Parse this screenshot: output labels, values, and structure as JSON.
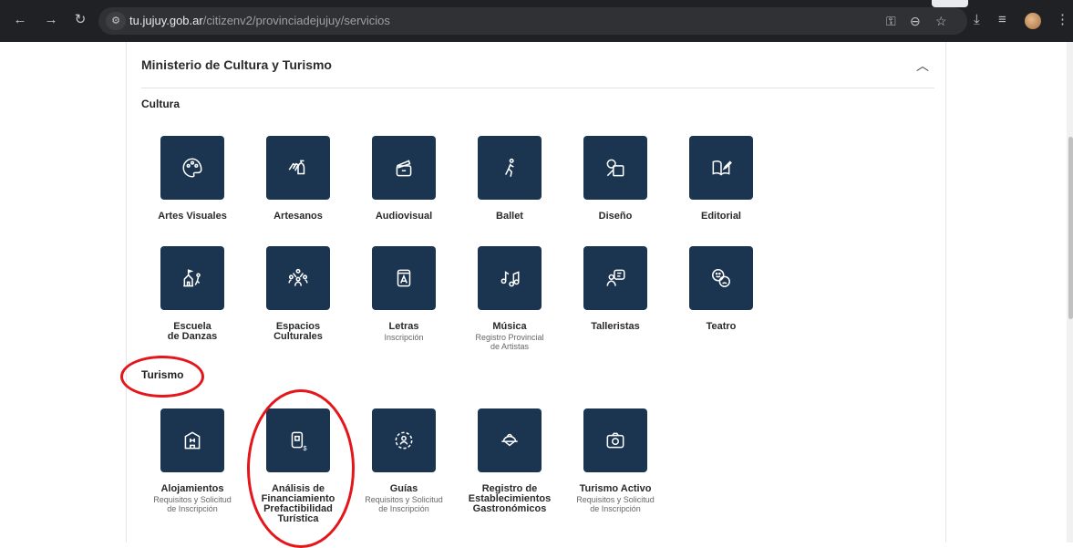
{
  "browser": {
    "url_host": "tu.jujuy.gob.ar",
    "url_path": "/citizenv2/provinciadejujuy/servicios",
    "site_info_icon": "tune-icon",
    "colors": {
      "frame": "#202124",
      "omnibox": "#303134"
    }
  },
  "panel": {
    "title": "Ministerio de Cultura y Turismo",
    "expanded": true
  },
  "cultura": {
    "heading": "Cultura",
    "row1": [
      {
        "label": "Artes Visuales",
        "icon": "palette-icon"
      },
      {
        "label": "Artesanos",
        "icon": "hands-pottery-icon"
      },
      {
        "label": "Audiovisual",
        "icon": "clapperboard-icon"
      },
      {
        "label": "Ballet",
        "icon": "dancer-icon"
      },
      {
        "label": "Diseño",
        "icon": "design-shapes-icon"
      },
      {
        "label": "Editorial",
        "icon": "book-pen-icon"
      }
    ],
    "row2": [
      {
        "label": "Escuela\nde Danzas",
        "icon": "dance-school-icon"
      },
      {
        "label": "Espacios\nCulturales",
        "icon": "community-icon"
      },
      {
        "label": "Letras",
        "sub": "Inscripción",
        "icon": "letter-card-icon"
      },
      {
        "label": "Música",
        "sub": "Registro Provincial\nde Artistas",
        "icon": "music-notes-icon"
      },
      {
        "label": "Talleristas",
        "icon": "presenter-icon"
      },
      {
        "label": "Teatro",
        "icon": "theater-masks-icon"
      }
    ]
  },
  "turismo": {
    "heading": "Turismo",
    "items": [
      {
        "label": "Alojamientos",
        "sub": "Requisitos y Solicitud\nde Inscripción",
        "icon": "hotel-icon"
      },
      {
        "label": "Análisis de\nFinanciamiento\nPrefactibilidad\nTurística",
        "icon": "building-money-icon"
      },
      {
        "label": "Guías",
        "sub": "Requisitos y Solicitud\nde Inscripción",
        "icon": "guide-person-icon"
      },
      {
        "label": "Registro de\nEstablecimientos\nGastronómicos",
        "icon": "food-dish-icon"
      },
      {
        "label": "Turismo Activo",
        "sub": "Requisitos y Solicitud\nde Inscripción",
        "icon": "camera-icon"
      }
    ]
  },
  "colors": {
    "tile": "#1b3550",
    "annotation": "#e5161b"
  }
}
